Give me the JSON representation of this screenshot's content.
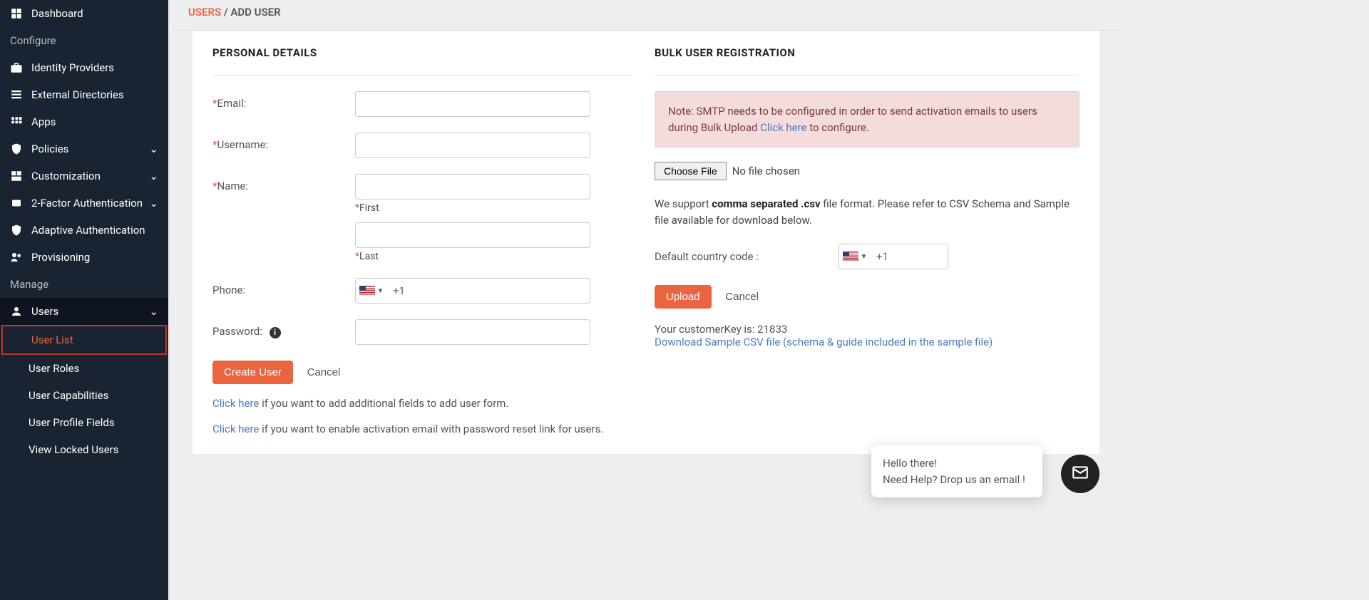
{
  "sidebar": {
    "dashboard": "Dashboard",
    "group_configure": "Configure",
    "identity_providers": "Identity Providers",
    "external_directories": "External Directories",
    "apps": "Apps",
    "policies": "Policies",
    "customization": "Customization",
    "two_factor": "2-Factor Authentication",
    "adaptive_auth": "Adaptive Authentication",
    "provisioning": "Provisioning",
    "group_manage": "Manage",
    "users": "Users",
    "user_list": "User List",
    "user_roles": "User Roles",
    "user_capabilities": "User Capabilities",
    "user_profile_fields": "User Profile Fields",
    "view_locked_users": "View Locked Users"
  },
  "breadcrumb": {
    "parent": "USERS",
    "current": "ADD USER"
  },
  "form": {
    "section_title": "PERSONAL DETAILS",
    "email_label": "Email:",
    "username_label": "Username:",
    "name_label": "Name:",
    "first_label": "First",
    "last_label": "Last",
    "phone_label": "Phone:",
    "phone_code": "+1",
    "password_label": "Password:",
    "create_btn": "Create User",
    "cancel_btn": "Cancel",
    "help1_link": "Click here",
    "help1_rest": " if you want to add additional fields to add user form.",
    "help2_link": "Click here",
    "help2_rest": " if you want to enable activation email with password reset link for users."
  },
  "bulk": {
    "section_title": "BULK USER REGISTRATION",
    "note_pre": "Note: SMTP needs to be configured in order to send activation emails to users during Bulk Upload ",
    "note_link": "Click here",
    "note_post": " to configure.",
    "choose_file": "Choose File",
    "no_file": "No file chosen",
    "support_pre": "We support ",
    "support_bold": "comma separated .csv",
    "support_post": " file format. Please refer to CSV Schema and Sample file available for download below.",
    "cc_label": "Default country code :",
    "cc_code": "+1",
    "upload_btn": "Upload",
    "cancel_btn": "Cancel",
    "key_text": "Your customerKey is: 21833",
    "download_link": "Download Sample CSV file (schema & guide included in the sample file)"
  },
  "chat": {
    "line1": "Hello there!",
    "line2": "Need Help? Drop us an email !"
  }
}
